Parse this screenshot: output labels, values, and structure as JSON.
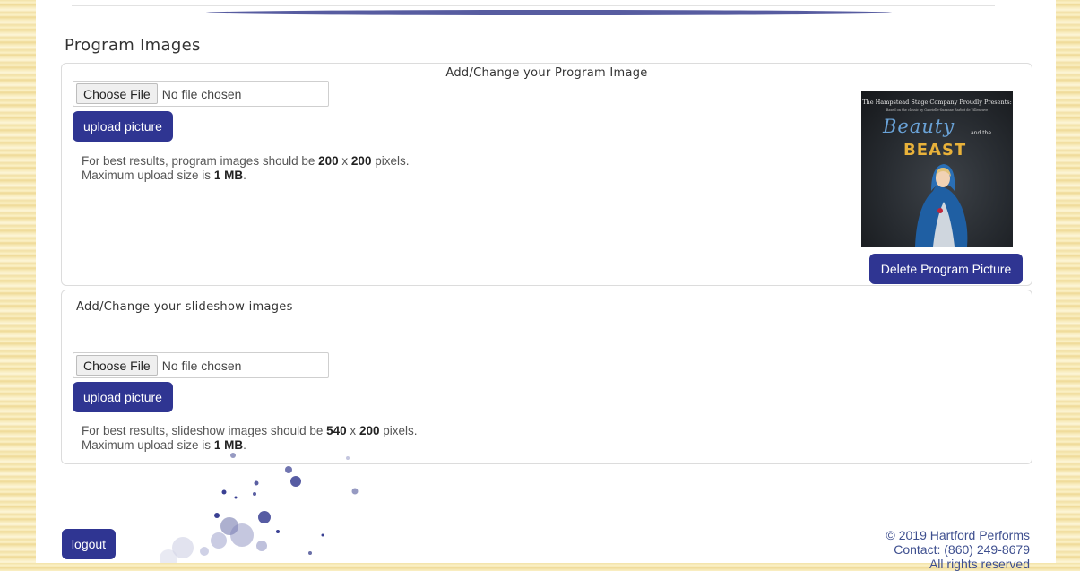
{
  "page": {
    "section_title": "Program Images"
  },
  "program_panel": {
    "heading": "Add/Change your Program Image",
    "file_button": "Choose File",
    "file_status": "No file chosen",
    "upload_label": "upload picture",
    "note_line1_pre": "For best results, program images should be ",
    "note_w": "200",
    "note_x": " x ",
    "note_h": "200",
    "note_line1_post": " pixels.",
    "note_line2_pre": "Maximum upload size is ",
    "note_size": "1 MB",
    "note_line2_post": ".",
    "poster": {
      "line1": "The Hampstead Stage Company Proudly Presents:",
      "line2": "Based on the classic by Gabrielle-Suzanne Barbot de Villeneuve",
      "beauty": "Beauty",
      "andthe": "and the",
      "beast": "BEAST"
    },
    "delete_label": "Delete Program Picture"
  },
  "slideshow_panel": {
    "heading": "Add/Change your slideshow images",
    "file_button": "Choose File",
    "file_status": "No file chosen",
    "upload_label": "upload picture",
    "note_line1_pre": "For best results, slideshow images should be ",
    "note_w": "540",
    "note_x": " x ",
    "note_h": "200",
    "note_line1_post": " pixels.",
    "note_line2_pre": "Maximum upload size is ",
    "note_size": "1 MB",
    "note_line2_post": "."
  },
  "footer": {
    "copyright": "© 2019 Hartford Performs",
    "contact": "Contact: (860) 249-8679",
    "rights": "All rights reserved"
  },
  "logout_label": "logout",
  "colors": {
    "button": "#2f3592",
    "footer_link": "#3e4f8f"
  }
}
